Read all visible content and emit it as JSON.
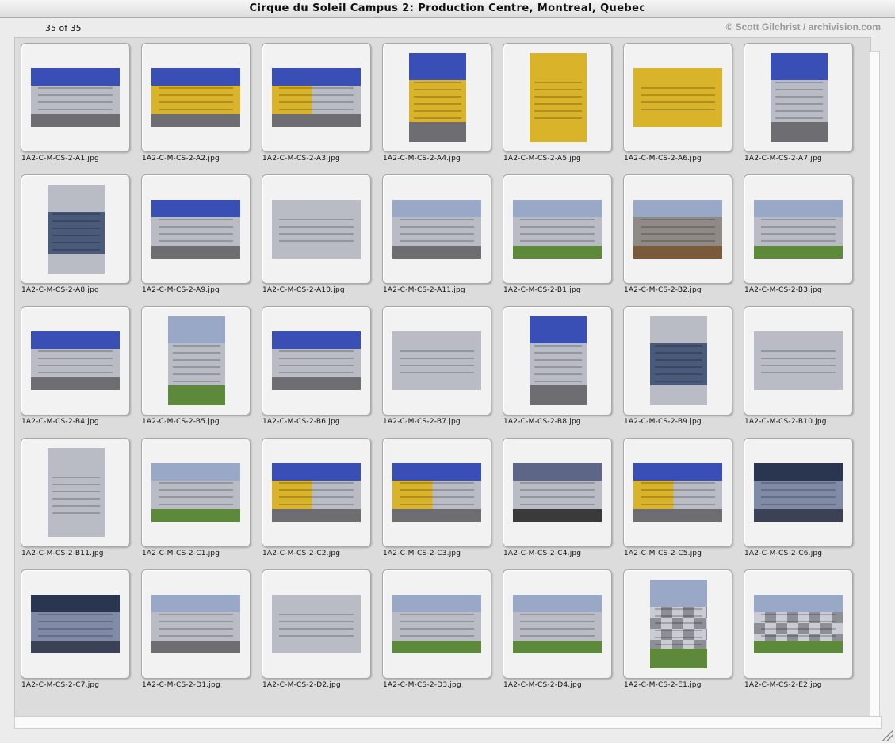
{
  "window": {
    "title": "Cirque du Soleil Campus 2: Production Centre, Montreal, Quebec"
  },
  "header": {
    "count": "35 of 35",
    "credit": "© Scott Gilchrist / archivision.com"
  },
  "colors": {
    "sky_blue": "#3a4fb6",
    "cloudy_sky": "#9aa8c8",
    "grey_facade": "#b9bcc4",
    "yellow_panels": "#d9b329",
    "grass": "#5d8a3a",
    "pavement": "#6e6e72"
  },
  "items": [
    {
      "filename": "1A2-C-M-CS-2-A1.jpg",
      "orientation": "landscape",
      "theme": "grey-blue"
    },
    {
      "filename": "1A2-C-M-CS-2-A2.jpg",
      "orientation": "landscape",
      "theme": "yellow"
    },
    {
      "filename": "1A2-C-M-CS-2-A3.jpg",
      "orientation": "landscape",
      "theme": "yellow-grey"
    },
    {
      "filename": "1A2-C-M-CS-2-A4.jpg",
      "orientation": "portrait",
      "theme": "yellow"
    },
    {
      "filename": "1A2-C-M-CS-2-A5.jpg",
      "orientation": "portrait",
      "theme": "yellow-full"
    },
    {
      "filename": "1A2-C-M-CS-2-A6.jpg",
      "orientation": "landscape",
      "theme": "yellow-full"
    },
    {
      "filename": "1A2-C-M-CS-2-A7.jpg",
      "orientation": "portrait",
      "theme": "grey-blue"
    },
    {
      "filename": "1A2-C-M-CS-2-A8.jpg",
      "orientation": "portrait",
      "theme": "glass"
    },
    {
      "filename": "1A2-C-M-CS-2-A9.jpg",
      "orientation": "landscape",
      "theme": "grey-blue"
    },
    {
      "filename": "1A2-C-M-CS-2-A10.jpg",
      "orientation": "landscape",
      "theme": "grey-facade"
    },
    {
      "filename": "1A2-C-M-CS-2-A11.jpg",
      "orientation": "landscape",
      "theme": "lot"
    },
    {
      "filename": "1A2-C-M-CS-2-B1.jpg",
      "orientation": "landscape",
      "theme": "garden"
    },
    {
      "filename": "1A2-C-M-CS-2-B2.jpg",
      "orientation": "landscape",
      "theme": "garden-dark"
    },
    {
      "filename": "1A2-C-M-CS-2-B3.jpg",
      "orientation": "landscape",
      "theme": "garden"
    },
    {
      "filename": "1A2-C-M-CS-2-B4.jpg",
      "orientation": "landscape",
      "theme": "grey-blue"
    },
    {
      "filename": "1A2-C-M-CS-2-B5.jpg",
      "orientation": "portrait",
      "theme": "path"
    },
    {
      "filename": "1A2-C-M-CS-2-B6.jpg",
      "orientation": "landscape",
      "theme": "grey-blue"
    },
    {
      "filename": "1A2-C-M-CS-2-B7.jpg",
      "orientation": "landscape",
      "theme": "grey-facade"
    },
    {
      "filename": "1A2-C-M-CS-2-B8.jpg",
      "orientation": "portrait",
      "theme": "grey-blue"
    },
    {
      "filename": "1A2-C-M-CS-2-B9.jpg",
      "orientation": "portrait",
      "theme": "glass"
    },
    {
      "filename": "1A2-C-M-CS-2-B10.jpg",
      "orientation": "landscape",
      "theme": "grey-facade"
    },
    {
      "filename": "1A2-C-M-CS-2-B11.jpg",
      "orientation": "portrait",
      "theme": "grey-facade"
    },
    {
      "filename": "1A2-C-M-CS-2-C1.jpg",
      "orientation": "landscape",
      "theme": "path"
    },
    {
      "filename": "1A2-C-M-CS-2-C2.jpg",
      "orientation": "landscape",
      "theme": "yellow-grey"
    },
    {
      "filename": "1A2-C-M-CS-2-C3.jpg",
      "orientation": "landscape",
      "theme": "yellow-grey"
    },
    {
      "filename": "1A2-C-M-CS-2-C4.jpg",
      "orientation": "landscape",
      "theme": "cloudy"
    },
    {
      "filename": "1A2-C-M-CS-2-C5.jpg",
      "orientation": "landscape",
      "theme": "yellow-grey"
    },
    {
      "filename": "1A2-C-M-CS-2-C6.jpg",
      "orientation": "landscape",
      "theme": "interior"
    },
    {
      "filename": "1A2-C-M-CS-2-C7.jpg",
      "orientation": "landscape",
      "theme": "interior"
    },
    {
      "filename": "1A2-C-M-CS-2-D1.jpg",
      "orientation": "landscape",
      "theme": "lot"
    },
    {
      "filename": "1A2-C-M-CS-2-D2.jpg",
      "orientation": "landscape",
      "theme": "grey-facade"
    },
    {
      "filename": "1A2-C-M-CS-2-D3.jpg",
      "orientation": "landscape",
      "theme": "garden"
    },
    {
      "filename": "1A2-C-M-CS-2-D4.jpg",
      "orientation": "landscape",
      "theme": "garden"
    },
    {
      "filename": "1A2-C-M-CS-2-E1.jpg",
      "orientation": "portrait",
      "theme": "checker"
    },
    {
      "filename": "1A2-C-M-CS-2-E2.jpg",
      "orientation": "landscape",
      "theme": "checker"
    }
  ]
}
